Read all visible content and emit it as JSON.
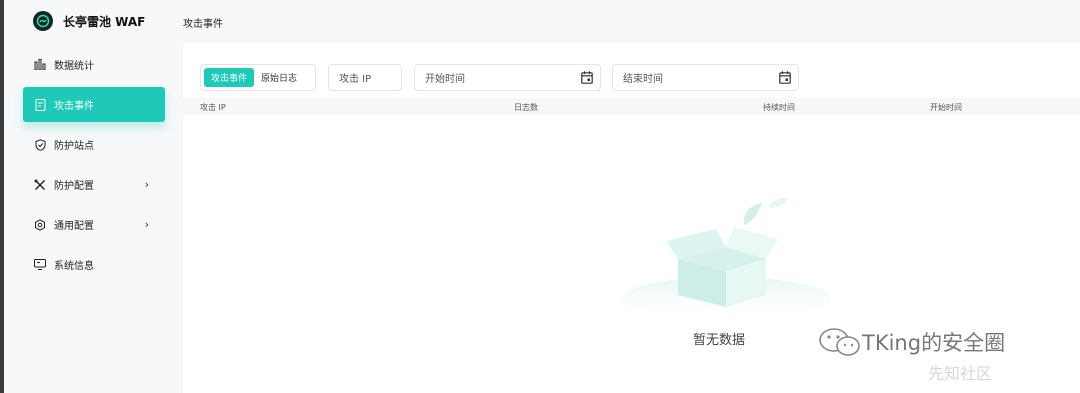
{
  "app": {
    "title": "长亭雷池 WAF"
  },
  "header": {
    "title": "攻击事件"
  },
  "sidebar": {
    "items": [
      {
        "label": "数据统计"
      },
      {
        "label": "攻击事件"
      },
      {
        "label": "防护站点"
      },
      {
        "label": "防护配置",
        "chevron": "›"
      },
      {
        "label": "通用配置",
        "chevron": "›"
      },
      {
        "label": "系统信息"
      }
    ]
  },
  "filters": {
    "tabs": [
      {
        "label": "攻击事件"
      },
      {
        "label": "原始日志"
      }
    ],
    "ip_placeholder": "攻击 IP",
    "start_placeholder": "开始时间",
    "end_placeholder": "结束时间"
  },
  "table": {
    "columns": [
      "攻击 IP",
      "日志数",
      "持续时间",
      "开始时间"
    ]
  },
  "empty": {
    "text": "暂无数据"
  },
  "watermark": {
    "text": "TKing的安全圈",
    "site": "先知社区"
  },
  "colors": {
    "accent": "#1ec9b7"
  }
}
